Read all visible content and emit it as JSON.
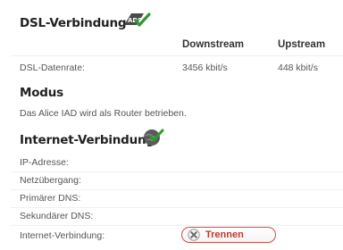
{
  "dsl": {
    "title": "DSL-Verbindung",
    "col_downstream": "Downstream",
    "col_upstream": "Upstream",
    "rate_label": "DSL-Datenrate:",
    "rate_down": "3456 kbit/s",
    "rate_up": "448 kbit/s",
    "icon": "adsl-check-icon"
  },
  "mode": {
    "title": "Modus",
    "text": "Das Alice IAD wird als Router betrieben."
  },
  "internet": {
    "title": "Internet-Verbindung",
    "icon": "globe-check-icon",
    "ip_label": "IP-Adresse:",
    "gateway_label": "Netzübergang:",
    "dns1_label": "Primärer DNS:",
    "dns2_label": "Sekundärer DNS:",
    "conn_label": "Internet-Verbindung:",
    "disconnect_label": "Trennen",
    "disconnect_icon": "close-icon"
  },
  "colors": {
    "accent_red": "#c0392b",
    "check_green": "#2e9a2e"
  }
}
